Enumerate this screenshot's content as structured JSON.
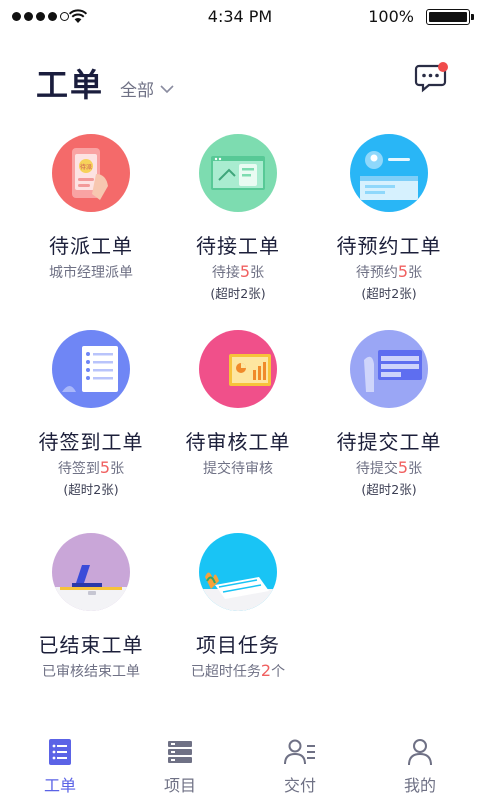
{
  "status_bar": {
    "time": "4:34 PM",
    "battery": "100%"
  },
  "header": {
    "title": "工单",
    "filter_label": "全部"
  },
  "colors": {
    "accent": "#5b63e6",
    "highlight": "#f06060",
    "badge": "#f04b4b"
  },
  "tiles": [
    {
      "name": "待派工单",
      "sub_prefix": "城市经理派单",
      "count": "",
      "sub_suffix": "",
      "note": "",
      "icon": "dispatch-phone-icon",
      "color": "#f46a6a"
    },
    {
      "name": "待接工单",
      "sub_prefix": "待接",
      "count": "5",
      "sub_suffix": "张",
      "note": "(超时2张)",
      "icon": "accept-map-icon",
      "color": "#7ddcb0"
    },
    {
      "name": "待预约工单",
      "sub_prefix": "待预约",
      "count": "5",
      "sub_suffix": "张",
      "note": "(超时2张)",
      "icon": "appointment-browser-icon",
      "color": "#29b6f6"
    },
    {
      "name": "待签到工单",
      "sub_prefix": "待签到",
      "count": "5",
      "sub_suffix": "张",
      "note": "(超时2张)",
      "icon": "checkin-list-icon",
      "color": "#6f86f5"
    },
    {
      "name": "待审核工单",
      "sub_prefix": "提交待审核",
      "count": "",
      "sub_suffix": "",
      "note": "",
      "icon": "review-chart-icon",
      "color": "#f0508a"
    },
    {
      "name": "待提交工单",
      "sub_prefix": "待提交",
      "count": "5",
      "sub_suffix": "张",
      "note": "(超时2张)",
      "icon": "submit-form-icon",
      "color": "#9aa6f5"
    },
    {
      "name": "已结束工单",
      "sub_prefix": "已审核结束工单",
      "count": "",
      "sub_suffix": "",
      "note": "",
      "icon": "finished-laptop-icon",
      "color": "#c9a6d8"
    },
    {
      "name": "项目任务",
      "sub_prefix": "已超时任务",
      "count": "2",
      "sub_suffix": "个",
      "note": "",
      "icon": "project-task-icon",
      "color": "#19c4f5"
    }
  ],
  "tabbar": [
    {
      "label": "工单",
      "icon": "workorder-list-icon",
      "active": true
    },
    {
      "label": "项目",
      "icon": "project-stack-icon",
      "active": false
    },
    {
      "label": "交付",
      "icon": "delivery-person-icon",
      "active": false
    },
    {
      "label": "我的",
      "icon": "profile-person-icon",
      "active": false
    }
  ]
}
